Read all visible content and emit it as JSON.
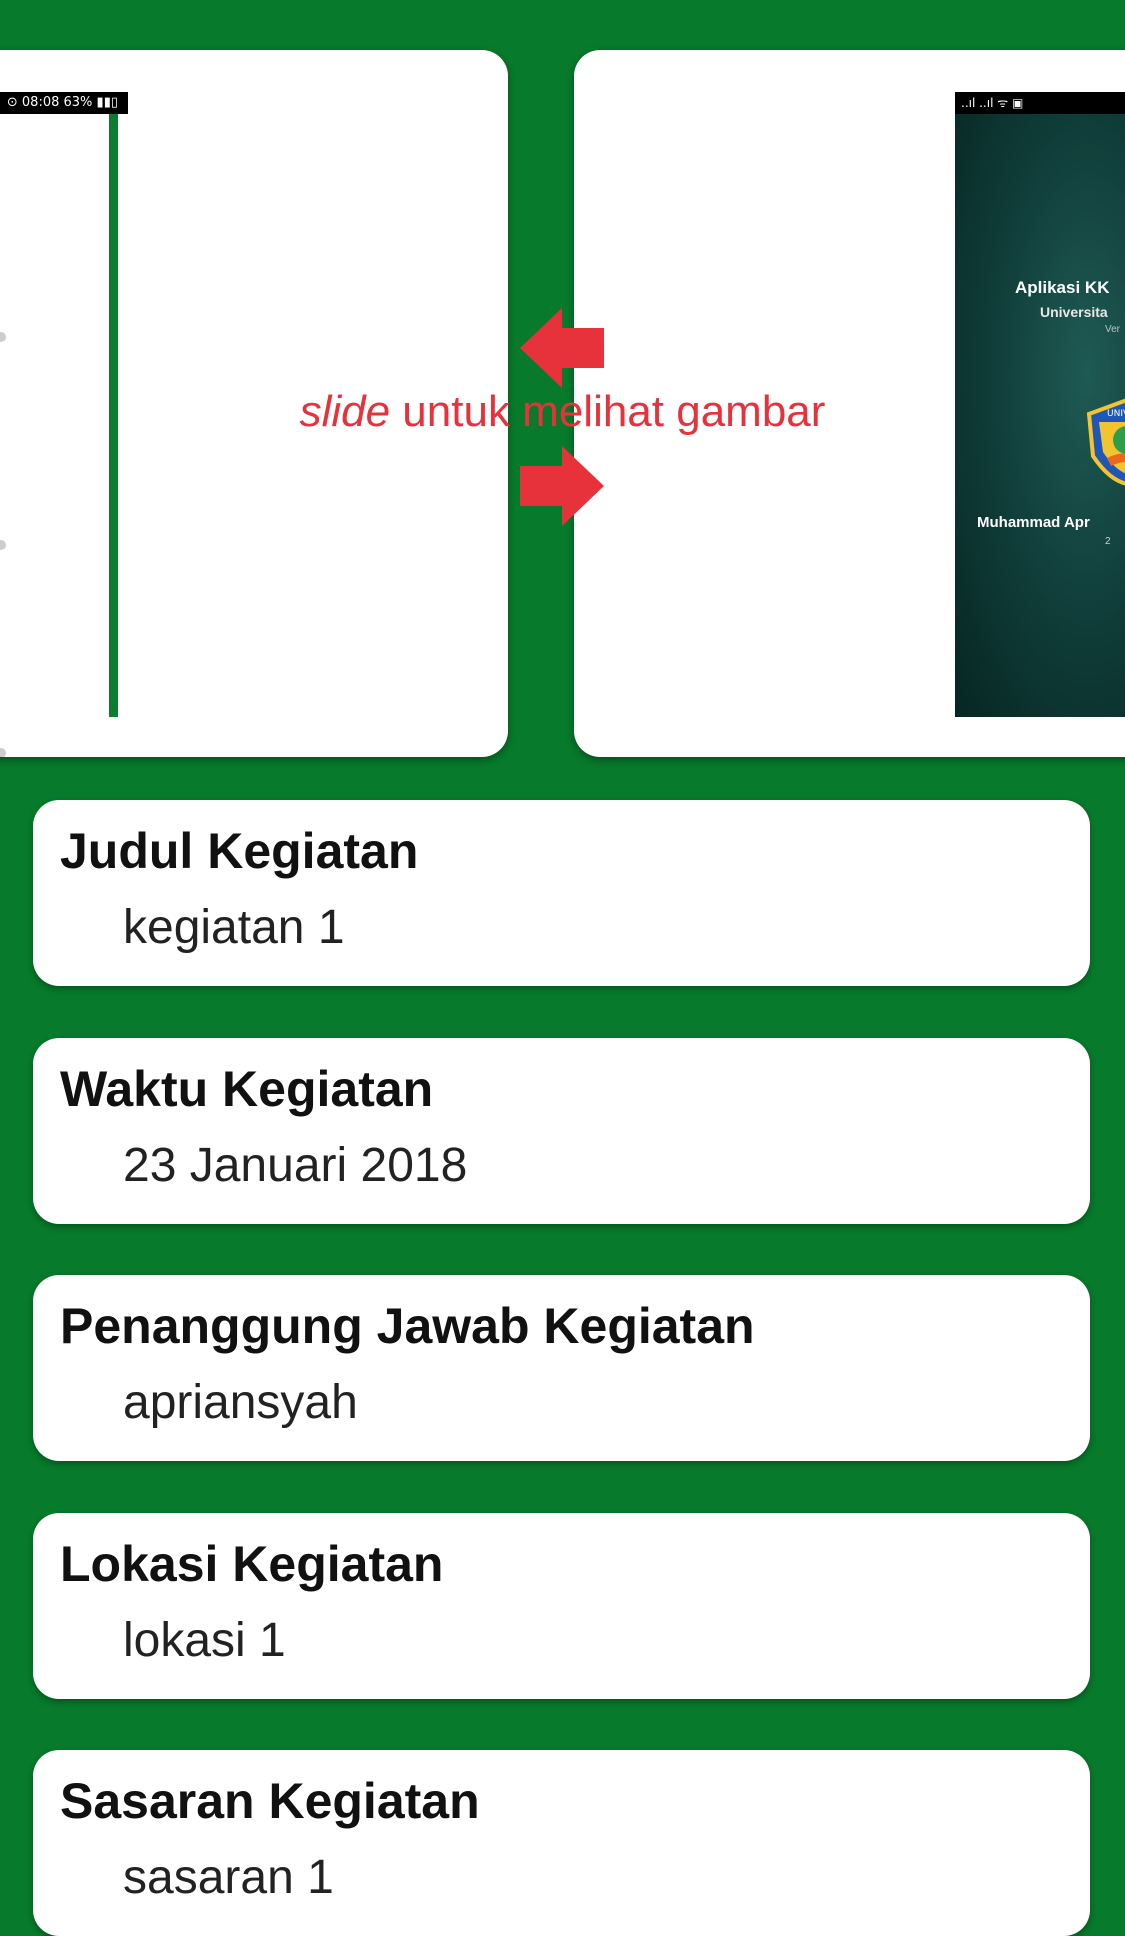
{
  "gallery": {
    "hint_emphasis": "slide",
    "hint_rest": " untuk melihat gambar",
    "left_screenshot": {
      "status_text": "⊙ 08:08 63% ▮▮▯"
    },
    "right_screenshot": {
      "status_text": "..ıl ..ıl ᯤ ▣",
      "title_line": "Aplikasi KK",
      "subtitle_line": "Universita",
      "version_line": "Ver",
      "logo_text": "UNIVERSITAS",
      "author_line": "Muhammad Apr",
      "year_line": "2"
    }
  },
  "fields": [
    {
      "label": "Judul Kegiatan",
      "value": "kegiatan 1"
    },
    {
      "label": "Waktu Kegiatan",
      "value": "23 Januari 2018"
    },
    {
      "label": "Penanggung Jawab Kegiatan",
      "value": "apriansyah"
    },
    {
      "label": "Lokasi Kegiatan",
      "value": "lokasi 1"
    },
    {
      "label": "Sasaran Kegiatan",
      "value": "sasaran 1"
    }
  ],
  "colors": {
    "background": "#077a2b",
    "card": "#ffffff",
    "hint": "#e8323b"
  },
  "icons": {
    "left_arrow": "arrow-left-icon",
    "right_arrow": "arrow-right-icon"
  }
}
